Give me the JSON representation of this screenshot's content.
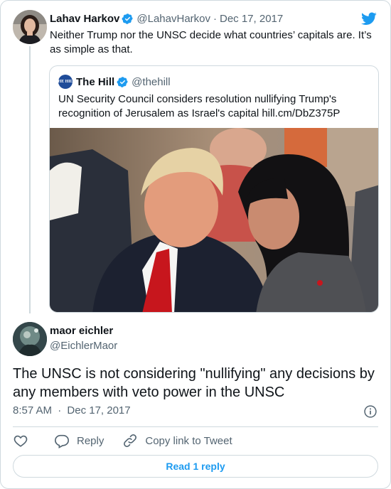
{
  "parent_tweet": {
    "author_name": "Lahav Harkov",
    "author_handle": "@LahavHarkov",
    "date": "Dec 17, 2017",
    "text": "Neither Trump nor the UNSC decide what countries’ capitals are. It’s as simple as that.",
    "icon": "verified-badge-icon"
  },
  "quoted_tweet": {
    "author_name": "The Hill",
    "author_handle": "@thehill",
    "logo_text": "THE HILL",
    "text": "UN Security Council considers resolution nullifying Trump's recognition of Jerusalem as Israel's capital hill.cm/DbZ375P"
  },
  "reply_tweet": {
    "author_name": "maor eichler",
    "author_handle": "@EichlerMaor",
    "text": "The UNSC is not considering \"nullifying\" any decisions by any members with veto power in the UNSC",
    "time": "8:57 AM",
    "date": "Dec 17, 2017"
  },
  "actions": {
    "like_icon": "heart-icon",
    "reply_label": "Reply",
    "copy_link_label": "Copy link to Tweet"
  },
  "read_replies_label": "Read 1 reply",
  "colors": {
    "twitter_blue": "#1d9bf0",
    "text": "#0f1419",
    "muted": "#536471",
    "border": "#cfd9de"
  }
}
